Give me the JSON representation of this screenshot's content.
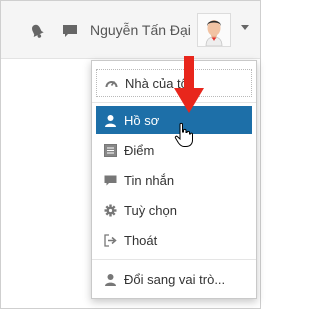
{
  "navbar": {
    "user_name": "Nguyễn Tấn Đại",
    "icons": [
      "notification-bell-icon",
      "messages-icon",
      "user-avatar",
      "caret-down-icon"
    ]
  },
  "menu": {
    "items": [
      {
        "label": "Nhà của tôi",
        "icon": "dashboard-icon"
      },
      {
        "label": "Hồ sơ",
        "icon": "user-icon",
        "active": true
      },
      {
        "label": "Điểm",
        "icon": "grades-icon"
      },
      {
        "label": "Tin nhắn",
        "icon": "message-icon"
      },
      {
        "label": "Tuỳ chọn",
        "icon": "gear-icon"
      },
      {
        "label": "Thoát",
        "icon": "logout-icon"
      },
      {
        "label": "Đổi sang vai trò...",
        "icon": "user-icon"
      }
    ]
  },
  "colors": {
    "active_bg": "#1d6fa8",
    "active_text": "#ffffff",
    "annotation_arrow": "#e8261c",
    "navbar_bg": "#f5f5f5"
  }
}
